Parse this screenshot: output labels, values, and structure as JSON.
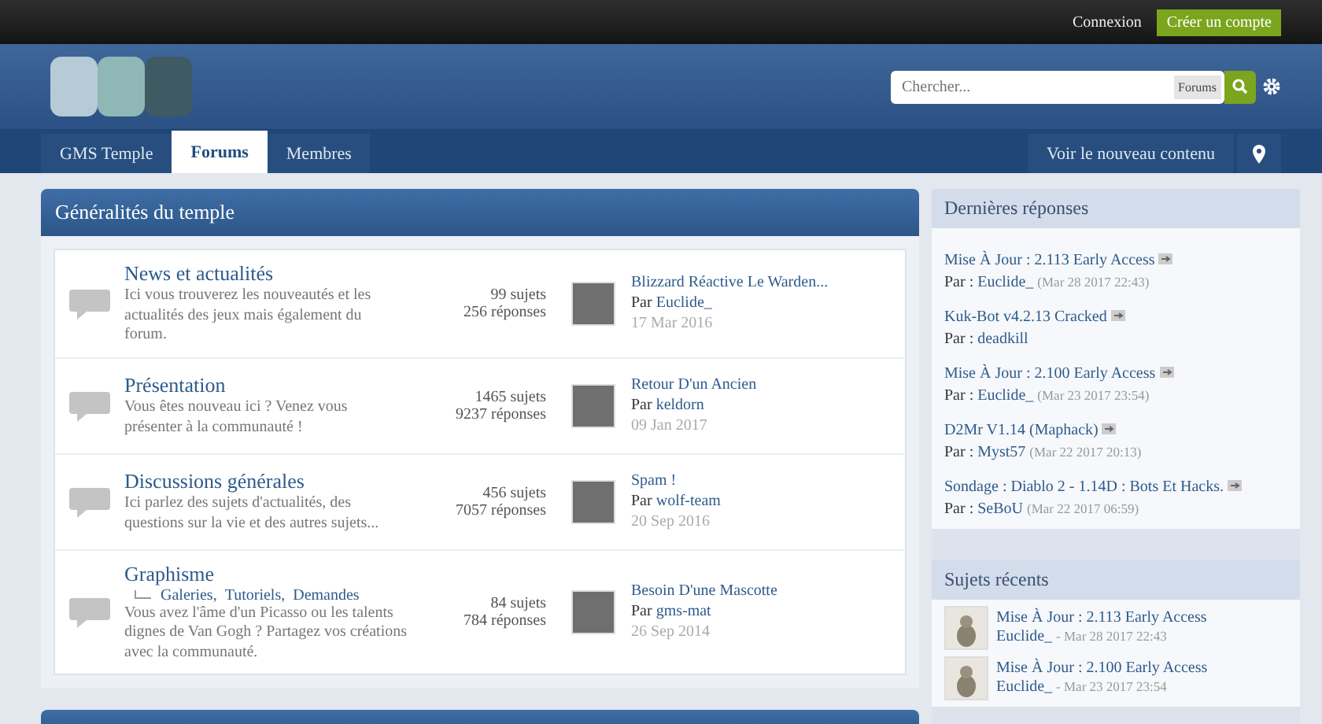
{
  "top_bar": {
    "links": [
      {
        "label": "Connexion",
        "kind": "link"
      },
      {
        "label": "Créer un compte",
        "kind": "button"
      }
    ]
  },
  "header": {
    "search": {
      "placeholder": "Chercher...",
      "scope": "Forums"
    }
  },
  "nav": {
    "tabs": [
      {
        "label": "GMS Temple",
        "selected": false
      },
      {
        "label": "Forums",
        "selected": true
      },
      {
        "label": "Membres",
        "selected": false
      }
    ],
    "new_content": "Voir le nouveau contenu"
  },
  "section": {
    "title": "Généralités du temple",
    "forums": [
      {
        "title": "News et actualités",
        "description": "Ici vous trouverez les nouveautés et les actualités des jeux mais également du forum.",
        "topics": "99 sujets",
        "replies": "256 réponses",
        "last_post": {
          "title": "Blizzard Réactive Le Warden...",
          "by": "Par",
          "author": "Euclide_",
          "date": "17 Mar 2016"
        }
      },
      {
        "title": "Présentation",
        "description": "Vous êtes nouveau ici ? Venez vous présenter à la communauté !",
        "topics": "1465 sujets",
        "replies": "9237 réponses",
        "last_post": {
          "title": "Retour D'un Ancien",
          "by": "Par",
          "author": "keldorn",
          "date": "09 Jan 2017"
        }
      },
      {
        "title": "Discussions générales",
        "description": "Ici parlez des sujets d'actualités, des questions sur la vie et des autres sujets...",
        "topics": "456 sujets",
        "replies": "7057 réponses",
        "last_post": {
          "title": "Spam !",
          "by": "Par",
          "author": "wolf-team",
          "date": "20 Sep 2016"
        }
      },
      {
        "title": "Graphisme",
        "subforums": [
          "Galeries,",
          "Tutoriels,",
          "Demandes"
        ],
        "description": "Vous avez l'âme d'un Picasso ou les talents dignes de Van Gogh ? Partagez vos créations avec la communauté.",
        "topics": "84 sujets",
        "replies": "784 réponses",
        "last_post": {
          "title": "Besoin D'une Mascotte",
          "by": "Par",
          "author": "gms-mat",
          "date": "26 Sep 2014"
        }
      }
    ]
  },
  "sidebar": {
    "latest_replies": {
      "title": "Dernières réponses",
      "items": [
        {
          "title": "Mise À Jour : 2.113 Early Access",
          "by": "Par :",
          "author": "Euclide_",
          "date": "(Mar 28 2017 22:43)"
        },
        {
          "title": "Kuk-Bot v4.2.13 Cracked",
          "by": "Par :",
          "author": "deadkill"
        },
        {
          "title": "Mise À Jour : 2.100 Early Access",
          "by": "Par :",
          "author": "Euclide_",
          "date": "(Mar 23 2017 23:54)"
        },
        {
          "title": "D2Mr V1.14 (Maphack)",
          "by": "Par :",
          "author": "Myst57",
          "date": "(Mar 22 2017 20:13)"
        },
        {
          "title": "Sondage : Diablo 2 - 1.14D : Bots Et Hacks.",
          "by": "Par :",
          "author": "SeBoU",
          "date": "(Mar 22 2017 06:59)"
        }
      ]
    },
    "recent_topics": {
      "title": "Sujets récents",
      "items": [
        {
          "title": "Mise À Jour : 2.113 Early Access",
          "author": "Euclide_",
          "date": "- Mar 28 2017 22:43"
        },
        {
          "title": "Mise À Jour : 2.100 Early Access",
          "author": "Euclide_",
          "date": "- Mar 23 2017 23:54"
        }
      ]
    }
  }
}
